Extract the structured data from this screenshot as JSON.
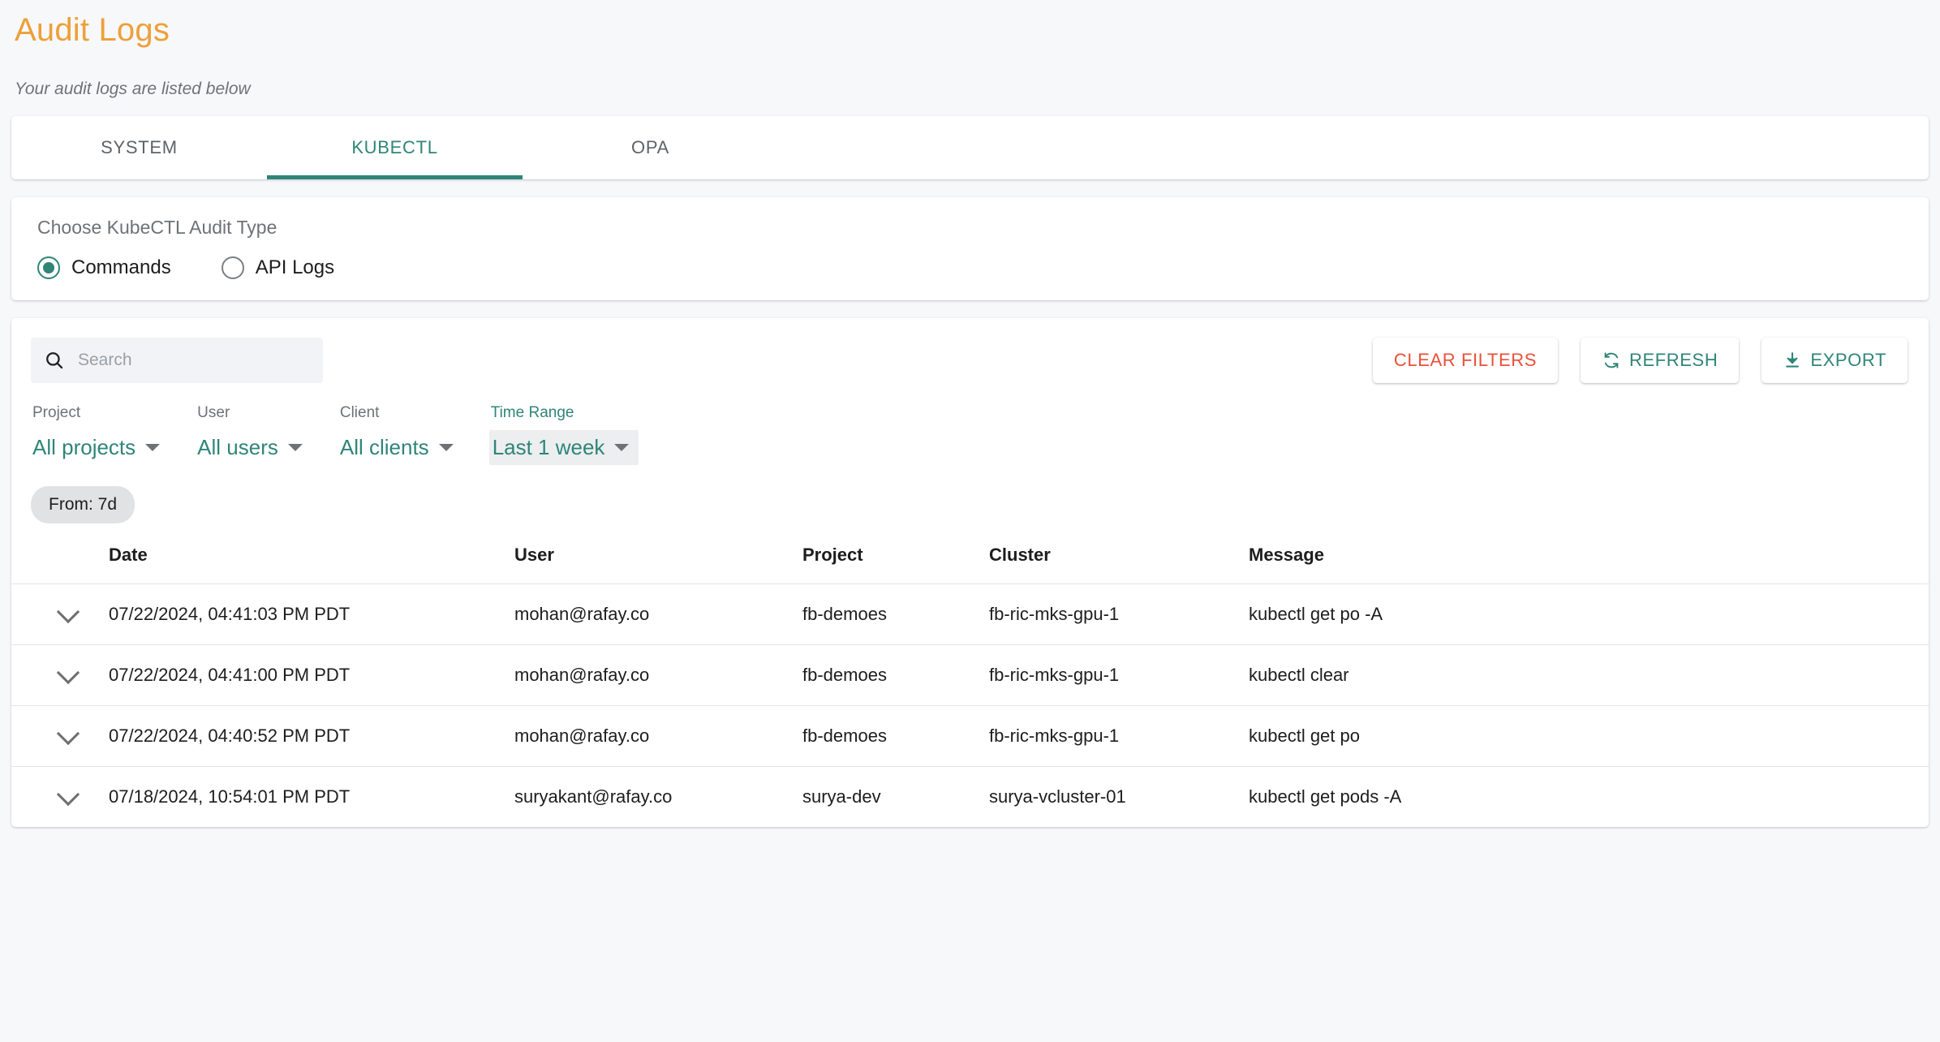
{
  "header": {
    "title": "Audit Logs",
    "subtitle": "Your audit logs are listed below"
  },
  "tabs": [
    {
      "label": "SYSTEM",
      "active": false
    },
    {
      "label": "KUBECTL",
      "active": true
    },
    {
      "label": "OPA",
      "active": false
    }
  ],
  "audit_type": {
    "label": "Choose KubeCTL Audit Type",
    "options": [
      {
        "label": "Commands",
        "selected": true
      },
      {
        "label": "API Logs",
        "selected": false
      }
    ]
  },
  "search": {
    "placeholder": "Search",
    "value": "",
    "icon": "search-icon"
  },
  "actions": {
    "clear_filters": "CLEAR FILTERS",
    "refresh": "REFRESH",
    "export": "EXPORT",
    "refresh_icon": "refresh-icon",
    "export_icon": "download-icon"
  },
  "filters": [
    {
      "label": "Project",
      "value": "All projects",
      "focused": false
    },
    {
      "label": "User",
      "value": "All users",
      "focused": false
    },
    {
      "label": "Client",
      "value": "All clients",
      "focused": false
    },
    {
      "label": "Time Range",
      "value": "Last 1 week",
      "focused": true
    }
  ],
  "chips": [
    {
      "label": "From: 7d"
    }
  ],
  "table": {
    "columns": [
      "",
      "Date",
      "User",
      "Project",
      "Cluster",
      "Message"
    ],
    "rows": [
      {
        "date": "07/22/2024, 04:41:03 PM PDT",
        "user": "mohan@rafay.co",
        "project": "fb-demoes",
        "cluster": "fb-ric-mks-gpu-1",
        "message": "kubectl get po -A"
      },
      {
        "date": "07/22/2024, 04:41:00 PM PDT",
        "user": "mohan@rafay.co",
        "project": "fb-demoes",
        "cluster": "fb-ric-mks-gpu-1",
        "message": "kubectl clear"
      },
      {
        "date": "07/22/2024, 04:40:52 PM PDT",
        "user": "mohan@rafay.co",
        "project": "fb-demoes",
        "cluster": "fb-ric-mks-gpu-1",
        "message": "kubectl get po"
      },
      {
        "date": "07/18/2024, 10:54:01 PM PDT",
        "user": "suryakant@rafay.co",
        "project": "surya-dev",
        "cluster": "surya-vcluster-01",
        "message": "kubectl get pods -A"
      }
    ]
  },
  "colors": {
    "title": "#eda03a",
    "accent": "#2f8578",
    "danger": "#e8503a",
    "page_bg": "#f7f8fa"
  }
}
